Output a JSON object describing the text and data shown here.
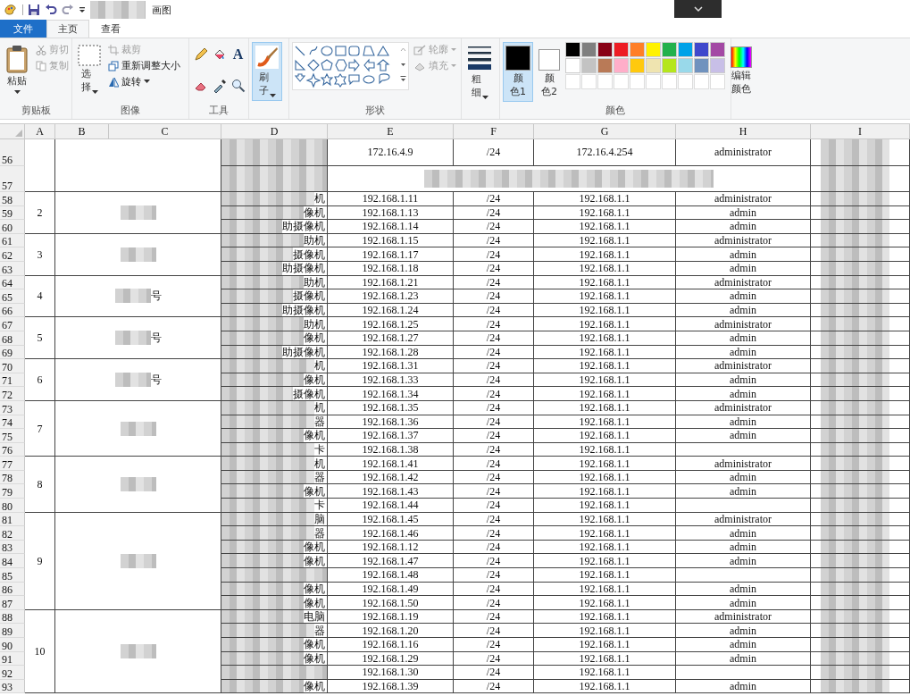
{
  "title_bar": {
    "title": "画图"
  },
  "tabs": [
    {
      "label": "文件",
      "kind": "file",
      "selected": false
    },
    {
      "label": "主页",
      "kind": "normal",
      "selected": true
    },
    {
      "label": "查看",
      "kind": "normal",
      "selected": false
    }
  ],
  "ribbon": {
    "clipboard": {
      "label": "剪贴板",
      "paste": "粘贴",
      "items": [
        {
          "kind": "cut",
          "label": "剪切",
          "disabled": true
        },
        {
          "kind": "copy",
          "label": "复制",
          "disabled": true
        }
      ]
    },
    "image": {
      "label": "图像",
      "select": "选择",
      "items": [
        {
          "kind": "crop",
          "label": "裁剪",
          "disabled": true
        },
        {
          "kind": "resize",
          "label": "重新调整大小",
          "disabled": false
        },
        {
          "kind": "rotate",
          "label": "旋转",
          "disabled": false
        }
      ]
    },
    "tools": {
      "label": "工具",
      "items": [
        {
          "kind": "pencil"
        },
        {
          "kind": "fill"
        },
        {
          "kind": "text",
          "glyph": "A"
        },
        {
          "kind": "eraser"
        },
        {
          "kind": "picker"
        },
        {
          "kind": "magnifier"
        }
      ]
    },
    "brush": {
      "label": "刷子",
      "selected": true
    },
    "shapes": {
      "label": "形状",
      "items": [
        {
          "kind": "outline",
          "label": "轮廓",
          "disabled": true
        },
        {
          "kind": "fill",
          "label": "填充",
          "disabled": true
        }
      ]
    },
    "size": {
      "label": "粗细"
    },
    "colors": {
      "label": "颜色",
      "slots": [
        {
          "label": "颜色1",
          "color": "#000000",
          "selected": true
        },
        {
          "label": "颜色2",
          "color": "#ffffff",
          "selected": false
        }
      ],
      "palette": [
        {
          "color": "#000000"
        },
        {
          "color": "#7f7f7f"
        },
        {
          "color": "#880015"
        },
        {
          "color": "#ed1c24"
        },
        {
          "color": "#ff7f27"
        },
        {
          "color": "#fff200"
        },
        {
          "color": "#22b14c"
        },
        {
          "color": "#00a2e8"
        },
        {
          "color": "#3f48cc"
        },
        {
          "color": "#a349a4"
        },
        {
          "color": "#ffffff"
        },
        {
          "color": "#c3c3c3"
        },
        {
          "color": "#b97a57"
        },
        {
          "color": "#ffaec9"
        },
        {
          "color": "#ffc90e"
        },
        {
          "color": "#efe4b0"
        },
        {
          "color": "#b5e61d"
        },
        {
          "color": "#99d9ea"
        },
        {
          "color": "#7092be"
        },
        {
          "color": "#c8bfe7"
        },
        {
          "empty": true
        },
        {
          "empty": true
        },
        {
          "empty": true
        },
        {
          "empty": true
        },
        {
          "empty": true
        },
        {
          "empty": true
        },
        {
          "empty": true
        },
        {
          "empty": true
        },
        {
          "empty": true
        },
        {
          "empty": true
        }
      ],
      "edit": "编辑颜色"
    }
  },
  "sheet": {
    "columns": [
      "A",
      "B",
      "C",
      "D",
      "E",
      "F",
      "G",
      "H",
      "I"
    ],
    "groups": [
      {
        "rows": [
          {
            "row": "56",
            "ip": "172.16.4.9",
            "mask": "/24",
            "gateway": "172.16.4.254",
            "user": "administrator"
          },
          {
            "row": "57"
          }
        ]
      },
      {
        "number": "2",
        "rows": [
          {
            "row": "58",
            "device": "机",
            "ip": "192.168.1.11",
            "mask": "/24",
            "gateway": "192.168.1.1",
            "user": "administrator"
          },
          {
            "row": "59",
            "device": "像机",
            "ip": "192.168.1.13",
            "mask": "/24",
            "gateway": "192.168.1.1",
            "user": "admin"
          },
          {
            "row": "60",
            "device": "助摄像机",
            "ip": "192.168.1.14",
            "mask": "/24",
            "gateway": "192.168.1.1",
            "user": "admin"
          }
        ]
      },
      {
        "number": "3",
        "rows": [
          {
            "row": "61",
            "device": "助机",
            "ip": "192.168.1.15",
            "mask": "/24",
            "gateway": "192.168.1.1",
            "user": "administrator"
          },
          {
            "row": "62",
            "device": "摄像机",
            "ip": "192.168.1.17",
            "mask": "/24",
            "gateway": "192.168.1.1",
            "user": "admin"
          },
          {
            "row": "63",
            "device": "助摄像机",
            "ip": "192.168.1.18",
            "mask": "/24",
            "gateway": "192.168.1.1",
            "user": "admin"
          }
        ]
      },
      {
        "number": "4",
        "name": "号",
        "rows": [
          {
            "row": "64",
            "device": "助机",
            "ip": "192.168.1.21",
            "mask": "/24",
            "gateway": "192.168.1.1",
            "user": "administrator"
          },
          {
            "row": "65",
            "device": "摄像机",
            "ip": "192.168.1.23",
            "mask": "/24",
            "gateway": "192.168.1.1",
            "user": "admin"
          },
          {
            "row": "66",
            "device": "助摄像机",
            "ip": "192.168.1.24",
            "mask": "/24",
            "gateway": "192.168.1.1",
            "user": "admin"
          }
        ]
      },
      {
        "number": "5",
        "name": "号",
        "rows": [
          {
            "row": "67",
            "device": "助机",
            "ip": "192.168.1.25",
            "mask": "/24",
            "gateway": "192.168.1.1",
            "user": "administrator"
          },
          {
            "row": "68",
            "device": "像机",
            "ip": "192.168.1.27",
            "mask": "/24",
            "gateway": "192.168.1.1",
            "user": "admin"
          },
          {
            "row": "69",
            "device": "助摄像机",
            "ip": "192.168.1.28",
            "mask": "/24",
            "gateway": "192.168.1.1",
            "user": "admin"
          }
        ]
      },
      {
        "number": "6",
        "name": "号",
        "rows": [
          {
            "row": "70",
            "device": "机",
            "ip": "192.168.1.31",
            "mask": "/24",
            "gateway": "192.168.1.1",
            "user": "administrator"
          },
          {
            "row": "71",
            "device": "像机",
            "ip": "192.168.1.33",
            "mask": "/24",
            "gateway": "192.168.1.1",
            "user": "admin"
          },
          {
            "row": "72",
            "device": "摄像机",
            "ip": "192.168.1.34",
            "mask": "/24",
            "gateway": "192.168.1.1",
            "user": "admin"
          }
        ]
      },
      {
        "number": "7",
        "rows": [
          {
            "row": "73",
            "device": "机",
            "ip": "192.168.1.35",
            "mask": "/24",
            "gateway": "192.168.1.1",
            "user": "administrator"
          },
          {
            "row": "74",
            "device": "器",
            "ip": "192.168.1.36",
            "mask": "/24",
            "gateway": "192.168.1.1",
            "user": "admin"
          },
          {
            "row": "75",
            "device": "像机",
            "ip": "192.168.1.37",
            "mask": "/24",
            "gateway": "192.168.1.1",
            "user": "admin"
          },
          {
            "row": "76",
            "device": "卡",
            "ip": "192.168.1.38",
            "mask": "/24",
            "gateway": "192.168.1.1"
          }
        ]
      },
      {
        "number": "8",
        "rows": [
          {
            "row": "77",
            "device": "机",
            "ip": "192.168.1.41",
            "mask": "/24",
            "gateway": "192.168.1.1",
            "user": "administrator"
          },
          {
            "row": "78",
            "device": "器",
            "ip": "192.168.1.42",
            "mask": "/24",
            "gateway": "192.168.1.1",
            "user": "admin"
          },
          {
            "row": "79",
            "device": "像机",
            "ip": "192.168.1.43",
            "mask": "/24",
            "gateway": "192.168.1.1",
            "user": "admin"
          },
          {
            "row": "80",
            "device": "卡",
            "ip": "192.168.1.44",
            "mask": "/24",
            "gateway": "192.168.1.1"
          }
        ]
      },
      {
        "number": "9",
        "rows": [
          {
            "row": "81",
            "device": "脑",
            "ip": "192.168.1.45",
            "mask": "/24",
            "gateway": "192.168.1.1",
            "user": "administrator"
          },
          {
            "row": "82",
            "device": "器",
            "ip": "192.168.1.46",
            "mask": "/24",
            "gateway": "192.168.1.1",
            "user": "admin"
          },
          {
            "row": "83",
            "device": "像机",
            "ip": "192.168.1.12",
            "mask": "/24",
            "gateway": "192.168.1.1",
            "user": "admin"
          },
          {
            "row": "84",
            "device": "像机",
            "ip": "192.168.1.47",
            "mask": "/24",
            "gateway": "192.168.1.1",
            "user": "admin"
          },
          {
            "row": "85",
            "ip": "192.168.1.48",
            "mask": "/24",
            "gateway": "192.168.1.1"
          },
          {
            "row": "86",
            "device": "像机",
            "ip": "192.168.1.49",
            "mask": "/24",
            "gateway": "192.168.1.1",
            "user": "admin"
          },
          {
            "row": "87",
            "device": "像机",
            "ip": "192.168.1.50",
            "mask": "/24",
            "gateway": "192.168.1.1",
            "user": "admin"
          }
        ]
      },
      {
        "number": "10",
        "rows": [
          {
            "row": "88",
            "device": "电脑",
            "ip": "192.168.1.19",
            "mask": "/24",
            "gateway": "192.168.1.1",
            "user": "administrator"
          },
          {
            "row": "89",
            "device": "器",
            "ip": "192.168.1.20",
            "mask": "/24",
            "gateway": "192.168.1.1",
            "user": "admin"
          },
          {
            "row": "90",
            "device": "像机",
            "ip": "192.168.1.16",
            "mask": "/24",
            "gateway": "192.168.1.1",
            "user": "admin"
          },
          {
            "row": "91",
            "device": "像机",
            "ip": "192.168.1.29",
            "mask": "/24",
            "gateway": "192.168.1.1",
            "user": "admin"
          },
          {
            "row": "92",
            "ip": "192.168.1.30",
            "mask": "/24",
            "gateway": "192.168.1.1"
          },
          {
            "row": "93",
            "device": "像机",
            "ip": "192.168.1.39",
            "mask": "/24",
            "gateway": "192.168.1.1",
            "user": "admin"
          }
        ]
      }
    ]
  }
}
